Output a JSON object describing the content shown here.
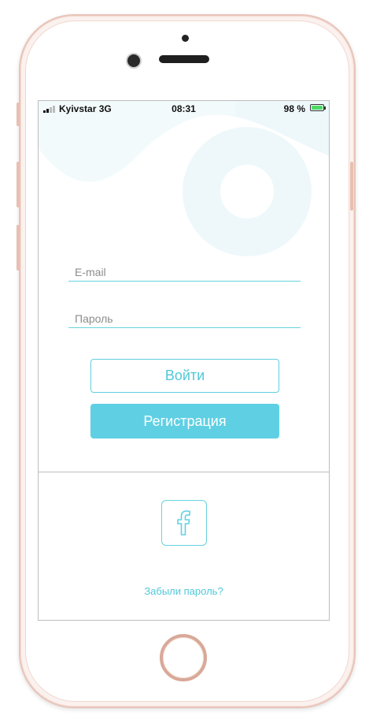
{
  "status_bar": {
    "carrier": "Kyivstar",
    "network": "3G",
    "time": "08:31",
    "battery_percent": "98 %",
    "signal_icon": "signal-bars-icon",
    "battery_icon": "battery-charging-icon"
  },
  "form": {
    "email_placeholder": "E-mail",
    "email_value": "",
    "password_placeholder": "Пароль",
    "password_value": ""
  },
  "buttons": {
    "login_label": "Войти",
    "register_label": "Регистрация"
  },
  "social": {
    "facebook_icon": "facebook-icon"
  },
  "links": {
    "forgot_password": "Забыли пароль?"
  },
  "colors": {
    "accent": "#5fd0e3",
    "decoration": "#eef8fb"
  }
}
